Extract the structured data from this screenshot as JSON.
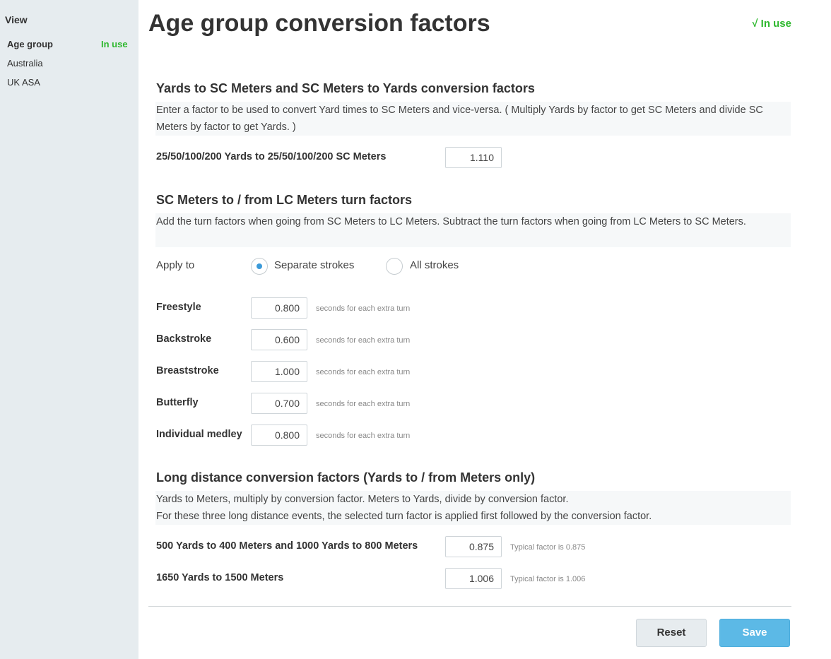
{
  "sidebar": {
    "heading": "View",
    "items": [
      {
        "label": "Age group",
        "active": true
      },
      {
        "label": "Australia",
        "active": false
      },
      {
        "label": "UK ASA",
        "active": false
      }
    ],
    "in_use_badge": "In use"
  },
  "header": {
    "title": "Age group conversion factors",
    "in_use": "√ In use"
  },
  "yards_section": {
    "title": "Yards to SC Meters and SC Meters to Yards conversion factors",
    "note": "Enter a factor to be used to convert Yard times to SC Meters and vice-versa. ( Multiply Yards by factor to get SC Meters and divide SC Meters by factor to get Yards. )",
    "row_label": "25/50/100/200 Yards to 25/50/100/200 SC Meters",
    "value": "1.110"
  },
  "turn_section": {
    "title": "SC Meters to / from LC Meters turn factors",
    "note": "Add the turn factors when going from SC Meters to LC Meters. Subtract the turn factors when going from LC Meters to SC Meters.",
    "apply_to_label": "Apply to",
    "options": [
      {
        "label": "Separate strokes",
        "selected": true
      },
      {
        "label": "All strokes",
        "selected": false
      }
    ],
    "hint": "seconds for each extra turn",
    "strokes": [
      {
        "label": "Freestyle",
        "value": "0.800"
      },
      {
        "label": "Backstroke",
        "value": "0.600"
      },
      {
        "label": "Breaststroke",
        "value": "1.000"
      },
      {
        "label": "Butterfly",
        "value": "0.700"
      },
      {
        "label": "Individual medley",
        "value": "0.800"
      }
    ]
  },
  "long_section": {
    "title": "Long distance conversion factors (Yards to / from Meters only)",
    "note_line1": "Yards to Meters, multiply by conversion factor. Meters to Yards, divide by conversion factor.",
    "note_line2": "For these three long distance events, the selected turn factor is applied first followed by the conversion factor.",
    "rows": [
      {
        "label": "500 Yards to 400 Meters and 1000 Yards to 800 Meters",
        "value": "0.875",
        "hint": "Typical factor is 0.875"
      },
      {
        "label": "1650 Yards to 1500 Meters",
        "value": "1.006",
        "hint": "Typical factor is 1.006"
      }
    ]
  },
  "actions": {
    "reset": "Reset",
    "save": "Save"
  },
  "colors": {
    "accent_green": "#2eb82e",
    "save_blue": "#5cb9e6",
    "radio_blue": "#3b9ad9",
    "sidebar_bg": "#e6ecef"
  }
}
